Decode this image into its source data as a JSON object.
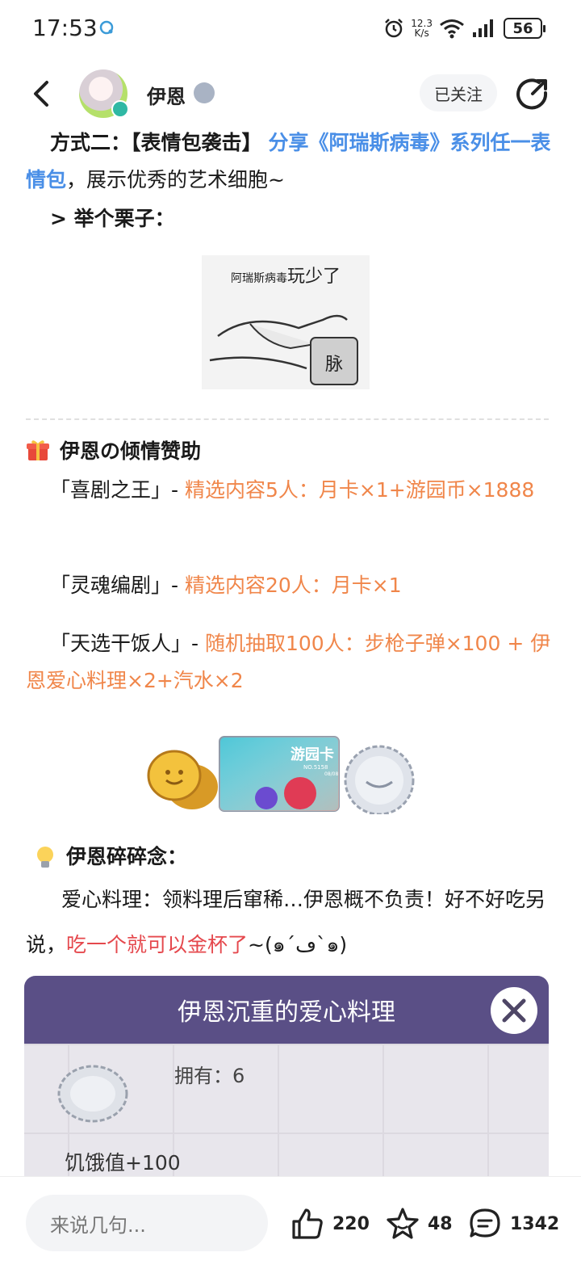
{
  "status_bar": {
    "time": "17:53",
    "net_speed_top": "12.3",
    "net_speed_bottom": "K/s",
    "battery": "56"
  },
  "header": {
    "author_name": "伊恩",
    "follow_label": "已关注"
  },
  "post": {
    "method_label": "方式二：【表情包袭击】",
    "method_link": "分享《阿瑞斯病毒》系列任一表情包",
    "method_tail": "，展示优秀的艺术细胞~",
    "example_label": "> 举个栗子：",
    "meme_caption_small": "阿瑞斯病毒",
    "meme_caption_big": "玩少了",
    "meme_block_char": "脉",
    "sponsor_title": "伊恩の倾情赞助",
    "rewards": [
      {
        "name": "「喜剧之王」-",
        "detail": "精选内容5人：月卡×1+游园币×1888"
      },
      {
        "name": "「灵魂编剧」-",
        "detail": "精选内容20人：月卡×1"
      },
      {
        "name": "「天选干饭人」-",
        "detail": "随机抽取100人：步枪子弹×100 + 伊恩爱心料理×2+汽水×2"
      }
    ],
    "card_title": "游园卡",
    "card_no": "NO.5158",
    "card_date": "08/08",
    "notes_title": "伊恩碎碎念：",
    "notes_text_a": "爱心料理：领料理后窜稀…伊恩概不负责！好不好吃另说，",
    "notes_text_red": "吃一个就可以金杯了",
    "notes_text_tail": "~(๑´ڡ`๑)"
  },
  "game_card": {
    "title": "伊恩沉重的爱心料理",
    "own_label": "拥有：6",
    "hunger_label": "饥饿值+100"
  },
  "bottom_bar": {
    "comment_placeholder": "来说几句...",
    "likes": "220",
    "favorites": "48",
    "comments": "1342"
  },
  "colors": {
    "link_blue": "#4a8fe7",
    "reward_orange": "#f0864a",
    "highlight_red": "#e5484d",
    "game_header_purple": "#5a4f86"
  }
}
